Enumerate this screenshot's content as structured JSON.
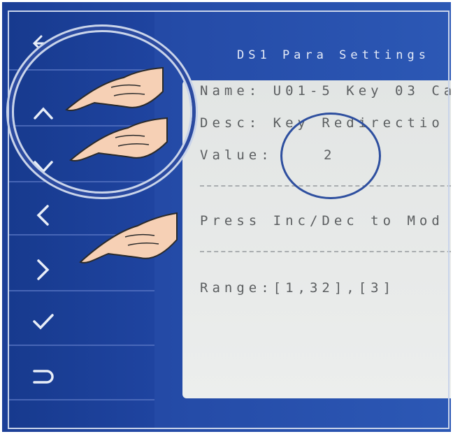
{
  "screen": {
    "title": "DS1 Para Settings",
    "name_line": "Name: U01-5 Key 03 Ca",
    "desc_line": "Desc: Key Redirectio",
    "value_label": "Value:",
    "value": "2",
    "press_line": "Press Inc/Dec to Mod",
    "range_line": "Range:[1,32],[3]"
  },
  "buttons": [
    {
      "name": "back-button",
      "icon": "arrow-left-icon"
    },
    {
      "name": "up-button",
      "icon": "chevron-up-icon"
    },
    {
      "name": "down-button",
      "icon": "chevron-down-icon"
    },
    {
      "name": "left-button",
      "icon": "chevron-left-icon"
    },
    {
      "name": "right-button",
      "icon": "chevron-right-icon"
    },
    {
      "name": "confirm-button",
      "icon": "checkmark-icon"
    },
    {
      "name": "return-button",
      "icon": "return-icon"
    }
  ],
  "colors": {
    "panel_blue": "#244aa6",
    "screen_gray": "#e5e7e6",
    "text_gray": "#5b5e60",
    "ring_blue": "#2e4f9f"
  }
}
